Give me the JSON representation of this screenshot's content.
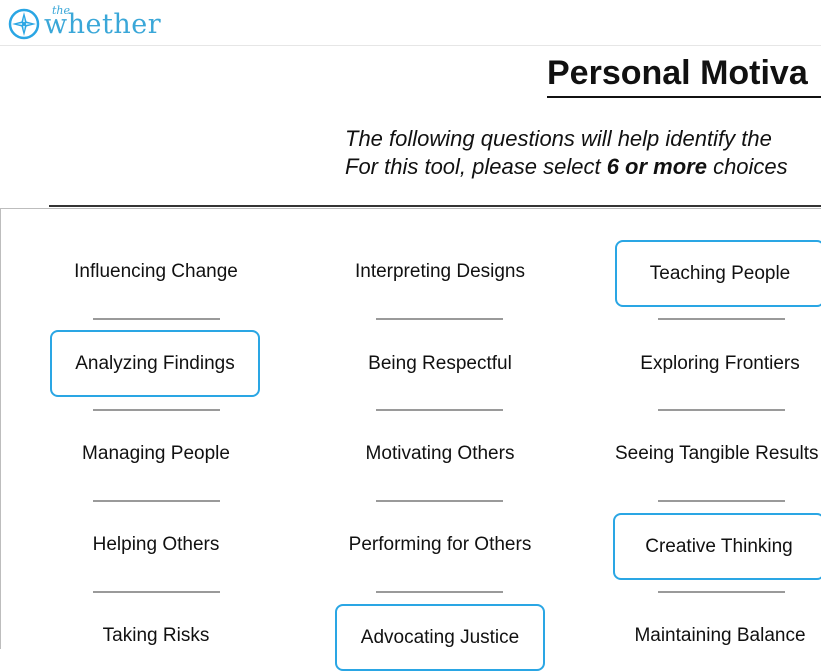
{
  "brand": {
    "small": "the",
    "name": "whether",
    "accent": "#2aa6e4"
  },
  "page": {
    "title": "Personal Motiva",
    "intro_line1": "The following questions will help identify the",
    "intro_line2_pre": "For this tool, please select ",
    "intro_line2_bold": "6 or more",
    "intro_line2_post": " choices"
  },
  "choices": {
    "influencing_change": "Influencing Change",
    "interpreting_designs": "Interpreting Designs",
    "teaching_people": "Teaching People",
    "analyzing_findings": "Analyzing Findings",
    "being_respectful": "Being Respectful",
    "exploring_frontiers": "Exploring Frontiers",
    "managing_people": "Managing People",
    "motivating_others": "Motivating Others",
    "seeing_tangible_results": "Seeing Tangible Results",
    "helping_others": "Helping Others",
    "performing_for_others": "Performing for Others",
    "creative_thinking": "Creative Thinking",
    "taking_risks": "Taking Risks",
    "advocating_justice": "Advocating Justice",
    "maintaining_balance": "Maintaining Balance"
  },
  "selected": [
    "teaching_people",
    "analyzing_findings",
    "creative_thinking",
    "advocating_justice"
  ]
}
